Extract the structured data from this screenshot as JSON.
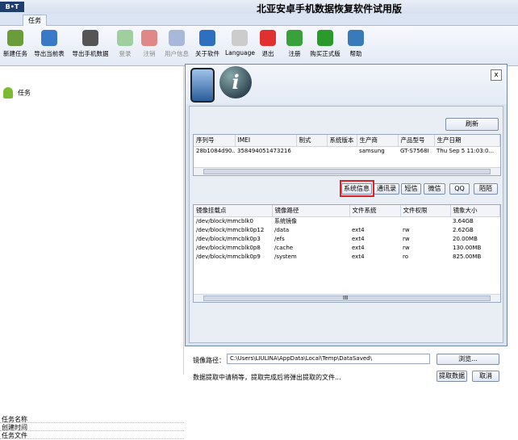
{
  "app": {
    "title": "北亚安卓手机数据恢复软件试用版",
    "tab": "任务"
  },
  "ribbon": [
    {
      "label": "新建任务",
      "icon": "new-task-icon",
      "color": "#6a9d3a",
      "enabled": true
    },
    {
      "label": "导出当前表",
      "icon": "export-table-icon",
      "color": "#3a78c8",
      "enabled": true
    },
    {
      "label": "导出手机数据",
      "icon": "export-phone-icon",
      "color": "#555555",
      "enabled": true
    },
    {
      "label": "登录",
      "icon": "login-icon",
      "color": "#9fcf9f",
      "enabled": false
    },
    {
      "label": "注销",
      "icon": "logout-icon",
      "color": "#e08888",
      "enabled": false
    },
    {
      "label": "用户信息",
      "icon": "user-info-icon",
      "color": "#a8b8d8",
      "enabled": false
    },
    {
      "label": "关于软件",
      "icon": "about-icon",
      "color": "#2f6fc0",
      "enabled": true
    },
    {
      "label": "Language",
      "icon": "language-icon",
      "color": "#cccccc",
      "enabled": true
    },
    {
      "label": "退出",
      "icon": "exit-icon",
      "color": "#e03030",
      "enabled": true
    },
    {
      "label": "注册",
      "icon": "register-icon",
      "color": "#3aa03a",
      "enabled": true
    },
    {
      "label": "购买正式版",
      "icon": "buy-icon",
      "color": "#2a9a2a",
      "enabled": true
    },
    {
      "label": "帮助",
      "icon": "help-icon",
      "color": "#3a7ab8",
      "enabled": true
    }
  ],
  "left": {
    "task_label": "任务",
    "props": [
      "任务名称",
      "创建时间",
      "任务文件"
    ]
  },
  "dialog": {
    "close": "x",
    "refresh": "刷新",
    "device_cols": [
      "序列号",
      "IMEI",
      "制式",
      "系统版本",
      "生产商",
      "产品型号",
      "生产日期"
    ],
    "device_rows": [
      [
        "28b1084d90...",
        "358494051473216",
        "",
        "",
        "samsung",
        "GT-S7568I",
        "Thu Sep  5 11:03:0..."
      ]
    ],
    "action_buttons": [
      "系统信息",
      "通讯录",
      "短信",
      "微信",
      "QQ",
      "陌陌"
    ],
    "mount_cols": [
      "镜像挂载点",
      "镜像路径",
      "文件系统",
      "文件权限",
      "镜象大小"
    ],
    "mount_rows": [
      [
        "/dev/block/mmcblk0",
        "系统镜像",
        "",
        "",
        "3.64GB"
      ],
      [
        "/dev/block/mmcblk0p12",
        "/data",
        "ext4",
        "rw",
        "2.62GB"
      ],
      [
        "/dev/block/mmcblk0p3",
        "/efs",
        "ext4",
        "rw",
        "20.00MB"
      ],
      [
        "/dev/block/mmcblk0p8",
        "/cache",
        "ext4",
        "rw",
        "130.00MB"
      ],
      [
        "/dev/block/mmcblk0p9",
        "/system",
        "ext4",
        "ro",
        "825.00MB"
      ]
    ],
    "scroll_mark": "III",
    "path_label": "镜像路径：",
    "path_value": "C:\\Users\\LIULINA\\AppData\\Local\\Temp\\DataSaved\\",
    "browse": "浏览...",
    "status": "数据提取中请稍等，提取完成后将弹出提取的文件...",
    "extract": "提取数据",
    "cancel": "取消"
  }
}
